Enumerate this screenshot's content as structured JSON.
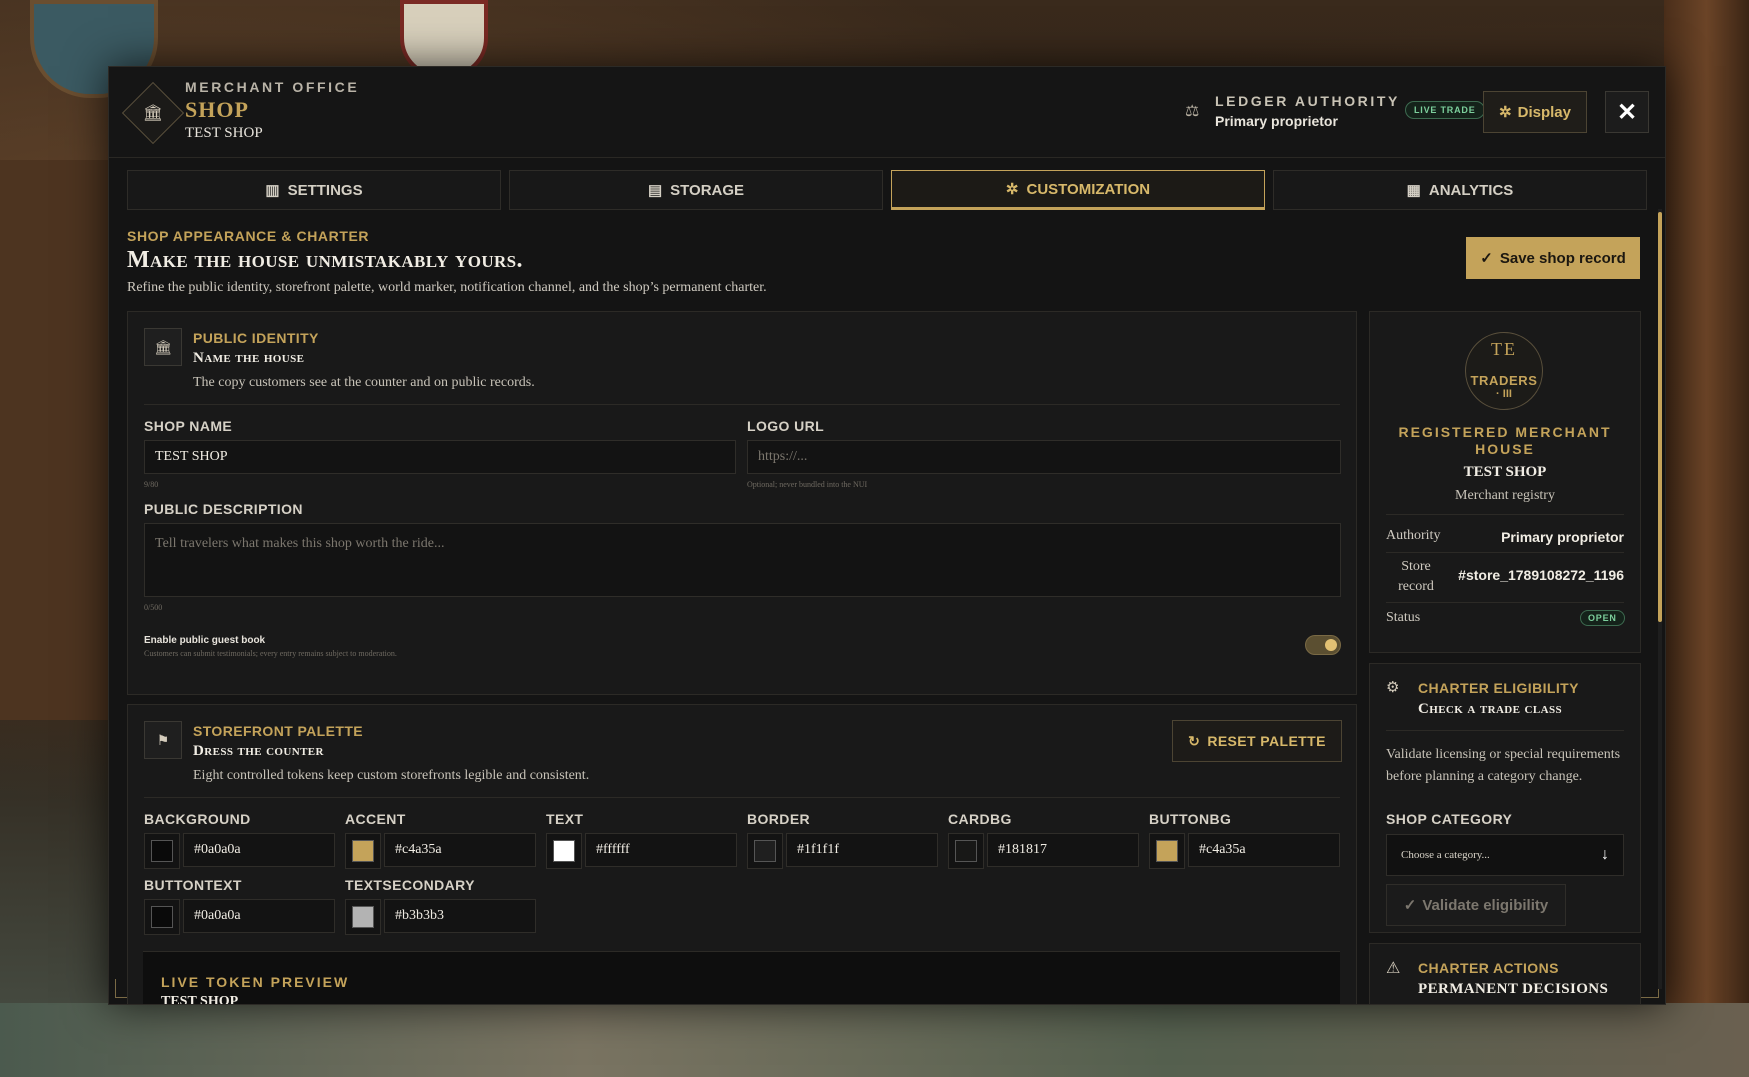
{
  "header": {
    "kicker": "MERCHANT OFFICE",
    "title": "SHOP",
    "shop_name": "TEST SHOP",
    "ledger_kicker": "LEDGER AUTHORITY",
    "ledger_value": "Primary proprietor",
    "live_badge": "LIVE TRADE",
    "display_label": "Display",
    "close_glyph": "✕"
  },
  "tabs": [
    {
      "label": "SETTINGS",
      "icon": "bar-chart-icon",
      "glyph": "▥",
      "active": false
    },
    {
      "label": "STORAGE",
      "icon": "box-icon",
      "glyph": "▤",
      "active": false
    },
    {
      "label": "CUSTOMIZATION",
      "icon": "gear-icon",
      "glyph": "✲",
      "active": true
    },
    {
      "label": "ANALYTICS",
      "icon": "document-icon",
      "glyph": "▦",
      "active": false
    }
  ],
  "section": {
    "kicker": "SHOP APPEARANCE & CHARTER",
    "title": "Make the house unmistakably yours.",
    "description": "Refine the public identity, storefront palette, world marker, notification channel, and the shop’s permanent charter.",
    "save_label": "Save shop record"
  },
  "identity": {
    "kicker": "PUBLIC IDENTITY",
    "title": "Name the house",
    "description": "The copy customers see at the counter and on public records.",
    "shop_name_label": "SHOP NAME",
    "shop_name_value": "TEST SHOP",
    "shop_name_count": "9/80",
    "logo_label": "LOGO URL",
    "logo_placeholder": "https://...",
    "logo_hint": "Optional; never bundled into the NUI",
    "desc_label": "PUBLIC DESCRIPTION",
    "desc_placeholder": "Tell travelers what makes this shop worth the ride...",
    "desc_count": "0/500",
    "guestbook_label": "Enable public guest book",
    "guestbook_hint": "Customers can submit testimonials; every entry remains subject to moderation.",
    "guestbook_enabled": true
  },
  "palette": {
    "kicker": "STOREFRONT PALETTE",
    "title": "Dress the counter",
    "description": "Eight controlled tokens keep custom storefronts legible and consistent.",
    "reset_label": "RESET PALETTE",
    "tokens": [
      {
        "label": "BACKGROUND",
        "value": "#0a0a0a",
        "color": "#0a0a0a"
      },
      {
        "label": "ACCENT",
        "value": "#c4a35a",
        "color": "#c4a35a"
      },
      {
        "label": "TEXT",
        "value": "#ffffff",
        "color": "#ffffff"
      },
      {
        "label": "BORDER",
        "value": "#1f1f1f",
        "color": "#1f1f1f"
      },
      {
        "label": "CARDBG",
        "value": "#181817",
        "color": "#181817"
      },
      {
        "label": "BUTTONBG",
        "value": "#c4a35a",
        "color": "#c4a35a"
      },
      {
        "label": "BUTTONTEXT",
        "value": "#0a0a0a",
        "color": "#0a0a0a"
      },
      {
        "label": "TEXTSECONDARY",
        "value": "#b3b3b3",
        "color": "#b3b3b3"
      }
    ],
    "preview_kicker": "LIVE TOKEN PREVIEW",
    "preview_name": "TEST SHOP"
  },
  "registry": {
    "seal_top": "TE",
    "seal_mid": "TRADERS",
    "seal_bottom": "· III",
    "heading": "REGISTERED MERCHANT HOUSE",
    "name": "TEST SHOP",
    "subtitle": "Merchant registry",
    "authority_label": "Authority",
    "authority_value": "Primary proprietor",
    "record_label": "Store record",
    "record_value": "#store_1789108272_1196",
    "status_label": "Status",
    "status_value": "OPEN"
  },
  "eligibility": {
    "kicker": "CHARTER ELIGIBILITY",
    "title": "Check a trade class",
    "description": "Validate licensing or special requirements before planning a category change.",
    "category_label": "SHOP CATEGORY",
    "category_placeholder": "Choose a category...",
    "validate_label": "Validate eligibility"
  },
  "actions": {
    "kicker": "CHARTER ACTIONS",
    "title": "PERMANENT DECISIONS"
  }
}
